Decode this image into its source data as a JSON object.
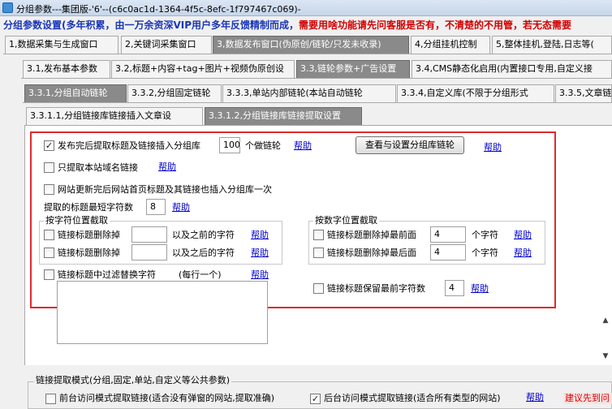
{
  "window": {
    "title": "分组参数---集团版-'6'--(c6c0ac1d-1364-4f5c-8efc-1f797467c069)-"
  },
  "notice": {
    "part1": "分组参数设置(多年积累，由一万余资深VIP用户多年反馈精制而成，",
    "part2": "需要用啥功能请先问客服是否有，不清楚的不用管，若无态需要"
  },
  "tabs_level1": [
    {
      "label": "1,数据采集与生成窗口"
    },
    {
      "label": "2,关键词采集窗口"
    },
    {
      "label": "3,数据发布窗口(伪原创/链轮/只发未收录)"
    },
    {
      "label": "4,分组挂机控制"
    },
    {
      "label": "5,整体挂机,登陆,日志等("
    }
  ],
  "tabs_level2": [
    {
      "label": "3.1,发布基本参数"
    },
    {
      "label": "3.2,标题+内容+tag+图片+视频伪原创设"
    },
    {
      "label": "3.3,链轮参数+广告设置"
    },
    {
      "label": "3.4,CMS静态化启用(内置接口专用,自定义接"
    }
  ],
  "tabs_level3": [
    {
      "label": "3.3.1,分组自动链轮"
    },
    {
      "label": "3.3.2,分组固定链轮"
    },
    {
      "label": "3.3.3,单站内部链轮(本站自动链轮"
    },
    {
      "label": "3.3.4,自定义库(不限于分组形式"
    },
    {
      "label": "3.3.5,文章链"
    }
  ],
  "tabs_level4": [
    {
      "label": "3.3.1.1,分组链接库链接插入文章设"
    },
    {
      "label": "3.3.1.2,分组链接库链接提取设置"
    }
  ],
  "settings": {
    "extract_title": {
      "label": "发布完后提取标题及链接插入分组库",
      "value": "100",
      "suffix": "个做链轮",
      "checked": "✓"
    },
    "view_button": "查看与设置分组库链轮",
    "only_domain": {
      "label": "只提取本站域名链接"
    },
    "update_homepage": {
      "label": "网站更新完后网站首页标题及其链接也插入分组库一次"
    },
    "min_title_len": {
      "label": "提取的标题最短字符数",
      "value": "8"
    },
    "char_group": {
      "title": "按字符位置截取",
      "delete_before": {
        "label": "链接标题删除掉",
        "suffix": "以及之前的字符"
      },
      "delete_after": {
        "label": "链接标题删除掉",
        "suffix": "以及之后的字符"
      }
    },
    "num_group": {
      "title": "按数字位置截取",
      "delete_front": {
        "label": "链接标题删除掉最前面",
        "value": "4",
        "suffix": "个字符"
      },
      "delete_back": {
        "label": "链接标题删除掉最后面",
        "value": "4",
        "suffix": "个字符"
      }
    },
    "filter_replace": {
      "label": "链接标题中过滤替换字符",
      "note": "(每行一个)"
    },
    "keep_front": {
      "label": "链接标题保留最前字符数",
      "value": "4"
    },
    "help": "帮助"
  },
  "bottom": {
    "group_title": "链接提取模式(分组,固定,单站,自定义等公共参数)",
    "front_mode": {
      "label": "前台访问模式提取链接(适合没有弹窗的网站,提取准确)"
    },
    "back_mode": {
      "label": "后台访问模式提取链接(适合所有类型的网站)",
      "checked": "✓"
    },
    "help": "帮助",
    "suggestion": "建议先到问"
  },
  "colors": {
    "accent_red": "#e02a2a",
    "notice_blue": "#1a36b8",
    "notice_red": "#d10000",
    "link_blue": "#0000cc"
  }
}
